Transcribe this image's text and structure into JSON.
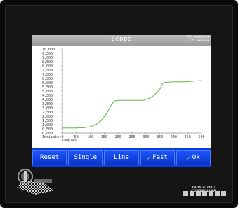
{
  "window": {
    "title": "Scope",
    "status_line1": "TRG ▪▪▪▪▪▪▪",
    "status_line2": "CH ▪▪▪▪▪▪"
  },
  "chart_data": {
    "type": "line",
    "title": "",
    "xlabel": "samples",
    "ylabel": "Indicator",
    "xlim": [
      0,
      500
    ],
    "ylim": [
      0,
      10000
    ],
    "x_ticks": [
      0,
      50,
      100,
      150,
      200,
      250,
      300,
      350,
      400,
      450,
      500
    ],
    "x_tick_labels": [
      "0",
      "50",
      "100",
      "150",
      "200",
      "250",
      "300",
      "350",
      "400",
      "450",
      "500"
    ],
    "y_ticks": [
      0,
      500,
      1000,
      1500,
      2000,
      2500,
      3000,
      3500,
      4000,
      4500,
      5000,
      5500,
      6000,
      6500,
      7000,
      7500,
      8000,
      8500,
      9000,
      9500,
      10000
    ],
    "y_tick_labels": [
      "0,000",
      "0,500",
      "1,000",
      "1,500",
      "2,000",
      "2,500",
      "3,000",
      "3,500",
      "4,000",
      "4,500",
      "5,000",
      "5,500",
      "6,000",
      "6,500",
      "7,000",
      "7,500",
      "8,000",
      "8,500",
      "9,000",
      "9,500",
      "10,000"
    ],
    "grid": false,
    "series": [
      {
        "color": "#4caf32",
        "x": [
          0,
          50,
          80,
          100,
          120,
          140,
          160,
          175,
          185,
          200,
          230,
          260,
          290,
          310,
          330,
          350,
          360,
          370,
          400,
          440,
          480,
          500
        ],
        "y": [
          600,
          600,
          650,
          750,
          1000,
          1500,
          2400,
          3300,
          3800,
          3900,
          3900,
          3900,
          3900,
          4100,
          4500,
          5200,
          5900,
          6050,
          6100,
          6100,
          6200,
          6250
        ]
      }
    ]
  },
  "buttons": [
    {
      "label": "Reset",
      "checked": false
    },
    {
      "label": "Single",
      "checked": false
    },
    {
      "label": "Line",
      "checked": false
    },
    {
      "label": "Fast",
      "checked": true
    },
    {
      "label": "Ok",
      "checked": true
    }
  ],
  "branding": {
    "logo_text": "PAVONE",
    "device_label": "INDICATOR / CONTROLLER",
    "colors": {
      "screen_title": "#a9a9a9",
      "button_bar": "#0d3fd8",
      "trace": "#4caf32"
    }
  }
}
